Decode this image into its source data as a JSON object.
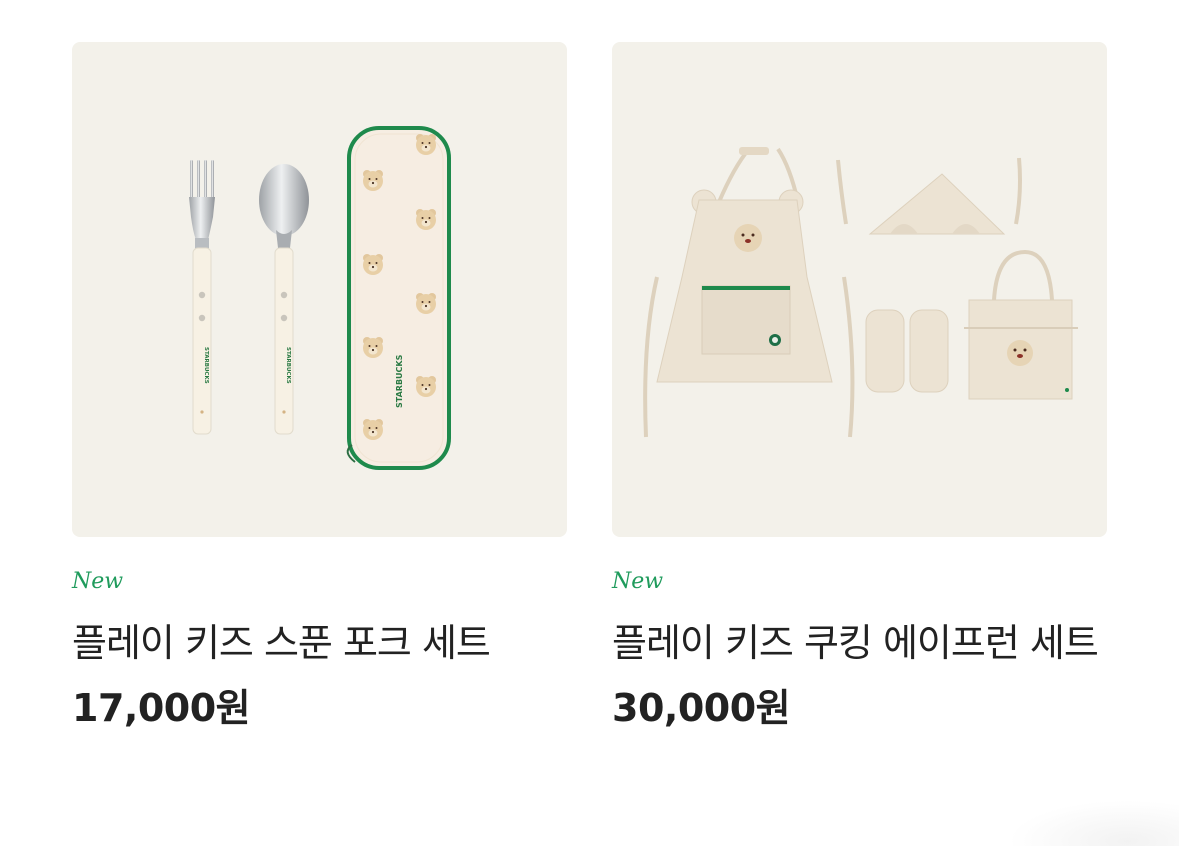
{
  "products": [
    {
      "badge": "New",
      "name": "플레이 키즈 스푼 포크 세트",
      "price": "17,000원",
      "image_icon": "cutlery-set-image",
      "print_text": "STARBUCKS"
    },
    {
      "badge": "New",
      "name": "플레이 키즈 쿠킹 에이프런 세트",
      "price": "30,000원",
      "image_icon": "apron-set-image"
    }
  ],
  "colors": {
    "badge": "#1f9b5c",
    "card_background": "#f3f1ea",
    "text": "#222222",
    "fabric": "#ece3d3",
    "zipper_green": "#1e8a4c"
  }
}
